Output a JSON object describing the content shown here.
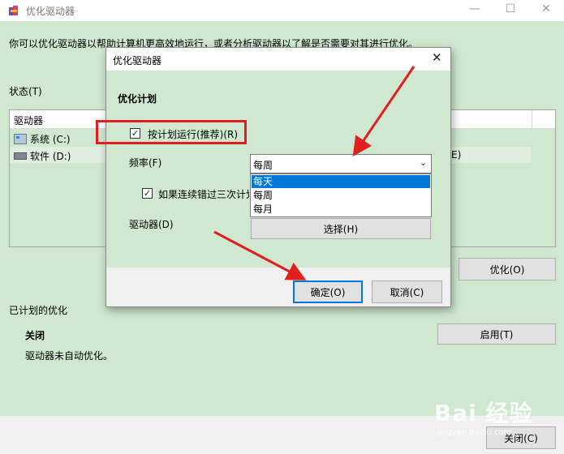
{
  "main_window": {
    "title": "优化驱动器",
    "description": "你可以优化驱动器以帮助计算机更高效地运行，或者分析驱动器以了解是否需要对其进行优化。",
    "status_label": "状态(T)",
    "table": {
      "column_drive": "驱动器",
      "rows": [
        {
          "name": "系统 (C:)",
          "icon": "windows-drive-icon"
        },
        {
          "name": "软件 (D:)",
          "icon": "drive-icon"
        }
      ],
      "partial_text": "E)"
    },
    "optimize_button": "优化(O)",
    "scheduled_label": "已计划的优化",
    "scheduled_state": "关闭",
    "scheduled_desc": "驱动器未自动优化。",
    "enable_button": "启用(T)",
    "close_button": "关闭(C)"
  },
  "dialog": {
    "title": "优化驱动器",
    "section_title": "优化计划",
    "run_on_schedule": "按计划运行(推荐)(R)",
    "run_on_schedule_checked": true,
    "frequency_label": "频率(F)",
    "frequency_value": "每周",
    "frequency_options": [
      "每天",
      "每周",
      "每月"
    ],
    "frequency_highlighted": "每天",
    "notify_checkbox": "如果连续错过三次计划",
    "notify_checked": true,
    "drives_label": "驱动器(D)",
    "choose_button": "选择(H)",
    "ok_button": "确定(O)",
    "cancel_button": "取消(C)"
  },
  "watermark": {
    "logo_text": "Bai 经验",
    "url": "jingyan.baidu.com"
  },
  "colors": {
    "window_bg": "#cfe8cf",
    "accent": "#0078d7",
    "annotation_red": "#e02020"
  }
}
